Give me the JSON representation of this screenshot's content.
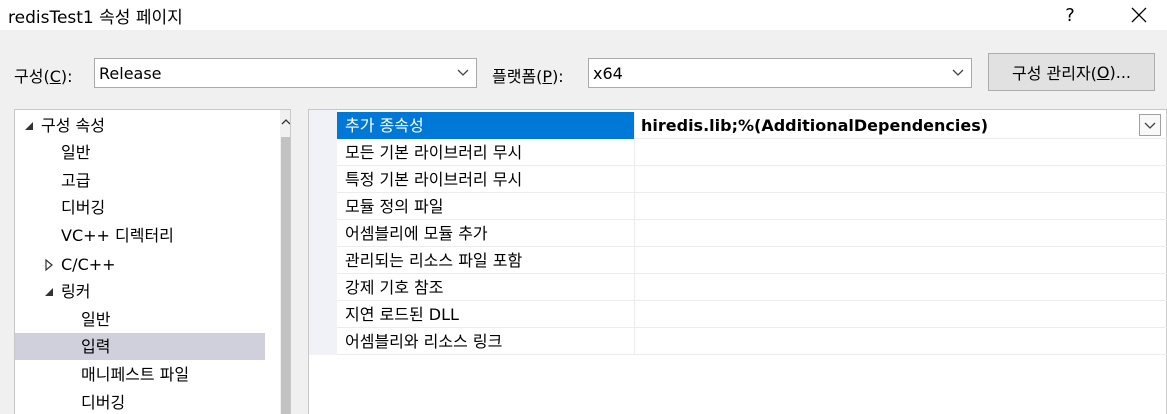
{
  "window": {
    "title": "redisTest1 속성 페이지",
    "help_label": "?",
    "close_label": "✕"
  },
  "config": {
    "label_prefix": "구성(",
    "label_key": "C",
    "label_suffix": "):",
    "value": "Release"
  },
  "platform": {
    "label_prefix": "플랫폼(",
    "label_key": "P",
    "label_suffix": "):",
    "value": "x64"
  },
  "config_manager": {
    "label_prefix": "구성 관리자(",
    "label_key": "O",
    "label_suffix": ")..."
  },
  "tree": {
    "items": [
      {
        "label": "구성 속성",
        "expander": "expanded"
      },
      {
        "label": "일반"
      },
      {
        "label": "고급"
      },
      {
        "label": "디버깅"
      },
      {
        "label": "VC++ 디렉터리"
      },
      {
        "label": "C/C++",
        "expander": "collapsed"
      },
      {
        "label": "링커",
        "expander": "expanded"
      },
      {
        "label": "일반"
      },
      {
        "label": "입력",
        "selected": true
      },
      {
        "label": "매니페스트 파일"
      },
      {
        "label": "디버깅"
      }
    ]
  },
  "properties": {
    "rows": [
      {
        "name": "추가 종속성",
        "value": "hiredis.lib;%(AdditionalDependencies)",
        "selected": true
      },
      {
        "name": "모든 기본 라이브러리 무시",
        "value": ""
      },
      {
        "name": "특정 기본 라이브러리 무시",
        "value": ""
      },
      {
        "name": "모듈 정의 파일",
        "value": ""
      },
      {
        "name": "어셈블리에 모듈 추가",
        "value": ""
      },
      {
        "name": "관리되는 리소스 파일 포함",
        "value": ""
      },
      {
        "name": "강제 기호 참조",
        "value": ""
      },
      {
        "name": "지연 로드된 DLL",
        "value": ""
      },
      {
        "name": "어셈블리와 리소스 링크",
        "value": ""
      }
    ]
  },
  "colors": {
    "selection_blue": "#0078d7",
    "tree_selection": "#cfd0dc"
  }
}
